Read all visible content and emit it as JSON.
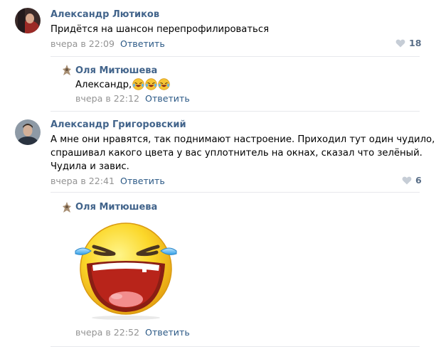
{
  "comments": [
    {
      "author": "Александр Лютиков",
      "text_lines": [
        "Придётся на шансон перепрофилироваться"
      ],
      "time": "вчера в 22:09",
      "reply_label": "Ответить",
      "likes": "18"
    },
    {
      "author": "Оля Митюшева",
      "text": "Александр,",
      "emoji_icon": "rofl-emoji-icon",
      "emoji_count": 3,
      "time": "вчера в 22:12",
      "reply_label": "Ответить"
    },
    {
      "author": "Александр Григоровский",
      "text_lines": [
        "А мне они нравятся, так поднимают настроение. Приходил тут один чудило,",
        "спрашивал какого цвета у вас уплотнитель на окнах, сказал что зелёный.",
        "Чудила и завис."
      ],
      "time": "вчера в 22:41",
      "reply_label": "Ответить",
      "likes": "6"
    },
    {
      "author": "Оля Митюшева",
      "sticker_icon": "laughing-tears-sticker-icon",
      "time": "вчера в 22:52",
      "reply_label": "Ответить"
    }
  ],
  "colors": {
    "author": "#42648b",
    "link": "#2a5885",
    "muted": "#939393",
    "separator": "#e7e8ec",
    "like": "#5a6f88"
  }
}
